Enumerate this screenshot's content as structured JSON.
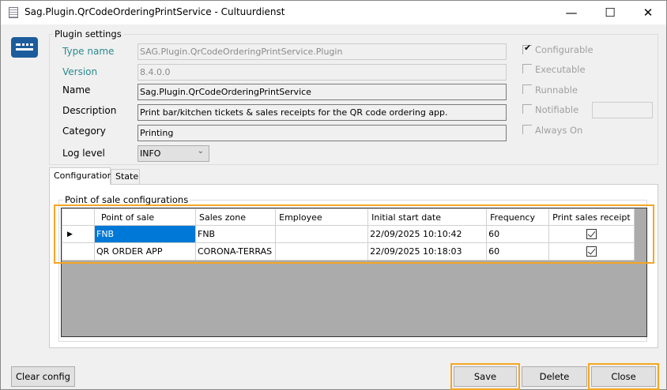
{
  "window": {
    "title": "Sag.Plugin.QrCodeOrderingPrintService - Cultuurdienst"
  },
  "plugin_settings": {
    "legend": "Plugin settings",
    "fields": [
      {
        "label": "Type name",
        "value": "SAG.Plugin.QrCodeOrderingPrintService.Plugin"
      },
      {
        "label": "Version",
        "value": "8.4.0.0"
      },
      {
        "label": "Name",
        "value": "Sag.Plugin.QrCodeOrderingPrintService"
      },
      {
        "label": "Description",
        "value": "Print bar/kitchen tickets & sales receipts for the QR code ordering app."
      },
      {
        "label": "Category",
        "value": "Printing"
      }
    ],
    "log_level": {
      "label": "Log level",
      "value": "INFO"
    },
    "checkboxes": [
      {
        "label": "Configurable",
        "checked": true
      },
      {
        "label": "Executable",
        "checked": false
      },
      {
        "label": "Runnable",
        "checked": false
      },
      {
        "label": "Notifiable",
        "checked": false
      },
      {
        "label": "Always On",
        "checked": false
      }
    ],
    "notifiable_value": ""
  },
  "tabs": [
    {
      "label": "Configuration",
      "active": true
    },
    {
      "label": "State",
      "active": false
    }
  ],
  "pos_config": {
    "legend": "Point of sale configurations",
    "columns": [
      "Point of sale",
      "Sales zone",
      "Employee",
      "Initial start date",
      "Frequency",
      "Print sales receipt"
    ],
    "rows": [
      {
        "pos": "FNB",
        "zone": "FNB",
        "employee": "",
        "start": "22/09/2025 10:10:42",
        "freq": "60",
        "print": true
      },
      {
        "pos": "QR ORDER APP",
        "zone": "CORONA-TERRAS",
        "employee": "",
        "start": "22/09/2025 10:18:03",
        "freq": "60",
        "print": true
      }
    ]
  },
  "buttons": {
    "clear": "Clear config",
    "save": "Save",
    "delete": "Delete",
    "close": "Close"
  },
  "colors": {
    "accent_highlight": "#f5a623",
    "selection": "#0078d7",
    "label_teal": "#2a8a8f"
  }
}
